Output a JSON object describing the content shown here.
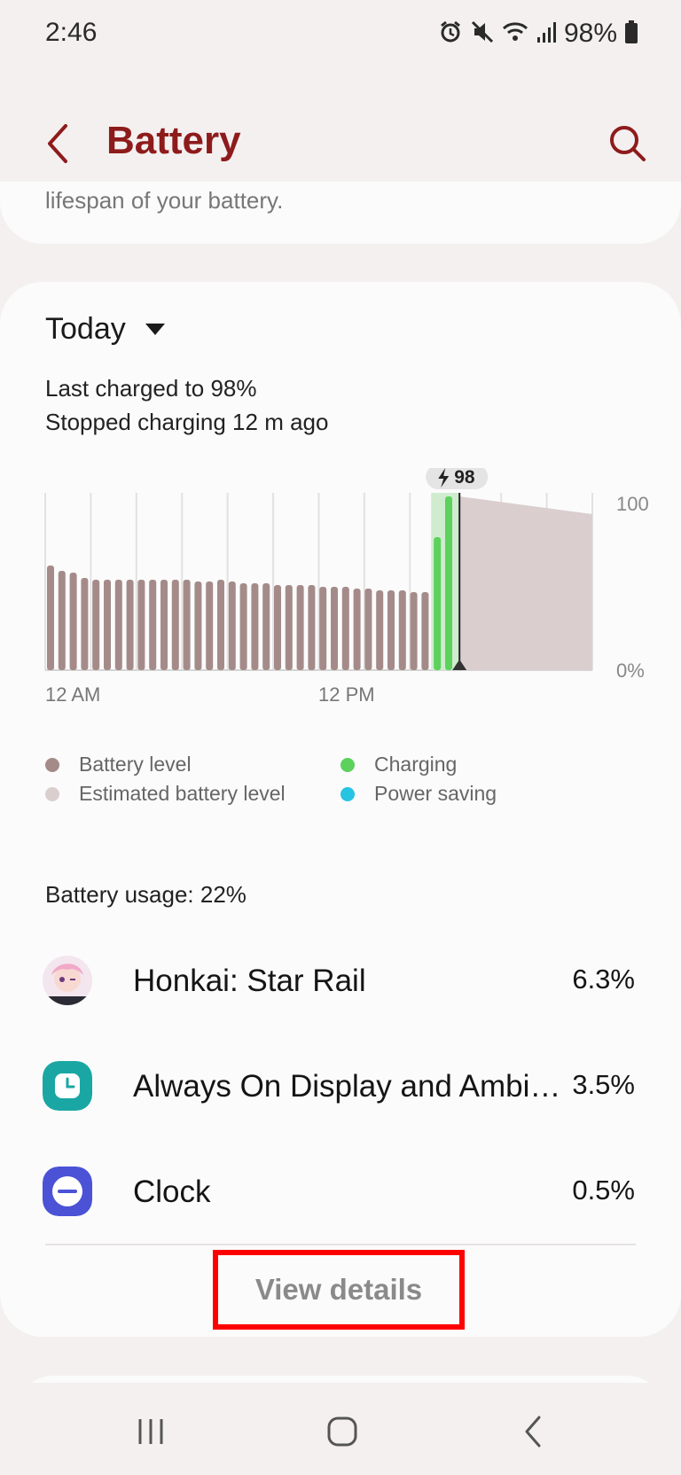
{
  "status_bar": {
    "time": "2:46",
    "battery_percent": "98%",
    "icons": [
      "alarm-icon",
      "mute-icon",
      "wifi-icon",
      "signal-icon",
      "battery-icon"
    ]
  },
  "header": {
    "title": "Battery",
    "back_icon": "back-chevron-icon",
    "search_icon": "search-icon",
    "accent_color": "#8e1b1b"
  },
  "top_card": {
    "partial_text": "lifespan of your battery."
  },
  "summary": {
    "period": "Today",
    "last_charged": "Last charged to 98%",
    "stopped_charging": "Stopped charging 12 m ago"
  },
  "chart_data": {
    "type": "bar",
    "x_start_label": "12 AM",
    "x_mid_label": "12 PM",
    "y_max_label": "100",
    "y_min_label": "0%",
    "ylim": [
      0,
      100
    ],
    "marker_label": "98",
    "battery_level": [
      59,
      56,
      55,
      52,
      51,
      51,
      51,
      51,
      51,
      51,
      51,
      51,
      51,
      50,
      50,
      51,
      50,
      49,
      49,
      49,
      48,
      48,
      48,
      48,
      47,
      47,
      47,
      46,
      46,
      45,
      45,
      45,
      44,
      44
    ],
    "charging_level": [
      75,
      98
    ],
    "estimated_start": 98,
    "estimated_end": 88,
    "colors": {
      "battery_level": "#a48b89",
      "estimated": "#dacfce",
      "charging": "#5cd15c",
      "power_saving": "#27c3e3"
    }
  },
  "legend": {
    "battery_level": "Battery level",
    "estimated": "Estimated battery level",
    "charging": "Charging",
    "power_saving": "Power saving"
  },
  "usage": {
    "title": "Battery usage: 22%",
    "apps": [
      {
        "name": "Honkai: Star Rail",
        "percent": "6.3%",
        "icon": "honkai-star-rail-icon"
      },
      {
        "name": "Always On Display and Ambient mode",
        "percent": "3.5%",
        "icon": "always-on-display-icon",
        "color": "#1aa7a3"
      },
      {
        "name": "Clock",
        "percent": "0.5%",
        "icon": "clock-icon",
        "color": "#4b52d6"
      }
    ],
    "view_details": "View details"
  },
  "nav": {
    "recents": "recents-icon",
    "home": "home-icon",
    "back": "back-icon"
  }
}
